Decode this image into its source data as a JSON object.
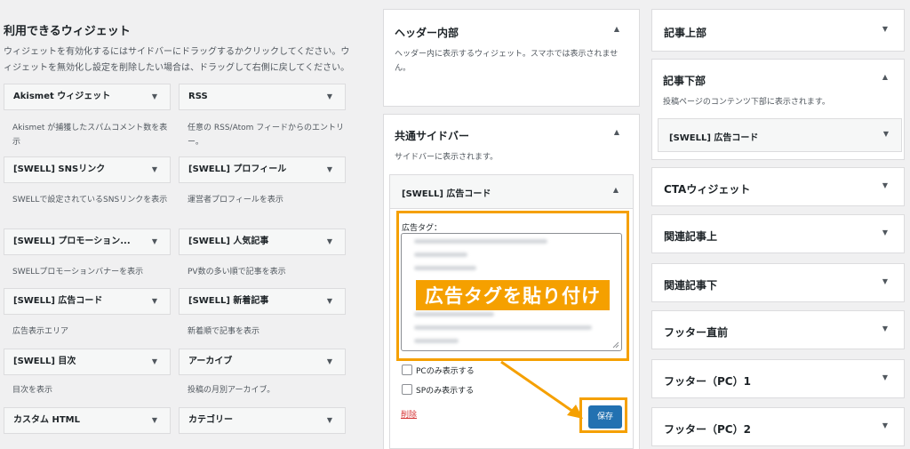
{
  "available": {
    "title": "利用できるウィジェット",
    "description": "ウィジェットを有効化するにはサイドバーにドラッグするかクリックしてください。ウィジェットを無効化し設定を削除したい場合は、ドラッグして右側に戻してください。",
    "widgets": [
      {
        "name": "Akismet ウィジェット",
        "desc": "Akismet が捕獲したスパムコメント数を表示"
      },
      {
        "name": "RSS",
        "desc": "任意の RSS/Atom フィードからのエントリー。"
      },
      {
        "name": "[SWELL] SNSリンク",
        "desc": "SWELLで設定されているSNSリンクを表示"
      },
      {
        "name": "[SWELL] プロフィール",
        "desc": "運営者プロフィールを表示"
      },
      {
        "name": "[SWELL] プロモーション...",
        "desc": "SWELLプロモーションバナーを表示"
      },
      {
        "name": "[SWELL] 人気記事",
        "desc": "PV数の多い順で記事を表示"
      },
      {
        "name": "[SWELL] 広告コード",
        "desc": "広告表示エリア"
      },
      {
        "name": "[SWELL] 新着記事",
        "desc": "新着順で記事を表示"
      },
      {
        "name": "[SWELL] 目次",
        "desc": "目次を表示"
      },
      {
        "name": "アーカイブ",
        "desc": "投稿の月別アーカイブ。"
      },
      {
        "name": "カスタム HTML",
        "desc": ""
      },
      {
        "name": "カテゴリー",
        "desc": ""
      }
    ]
  },
  "middle": {
    "header_inner": {
      "title": "ヘッダー内部",
      "desc": "ヘッダー内に表示するウィジェット。スマホでは表示されません。"
    },
    "common_sidebar": {
      "title": "共通サイドバー",
      "desc": "サイドバーに表示されます。"
    },
    "ad_widget": {
      "title": "[SWELL] 広告コード",
      "field_label": "広告タグ：",
      "overlay": "広告タグを貼り付け",
      "pc_only": "PCのみ表示する",
      "sp_only": "SPのみ表示する",
      "delete": "削除",
      "save": "保存"
    }
  },
  "right": {
    "article_top": "記事上部",
    "article_bottom": {
      "title": "記事下部",
      "desc": "投稿ページのコンテンツ下部に表示されます。",
      "inner": "[SWELL] 広告コード"
    },
    "boxes": [
      "CTAウィジェット",
      "関連記事上",
      "関連記事下",
      "フッター直前",
      "フッター（PC）1",
      "フッター（PC）2"
    ]
  },
  "colors": {
    "highlight": "#f5a000",
    "primary_button": "#2271b1",
    "delete_link": "#d63638"
  }
}
